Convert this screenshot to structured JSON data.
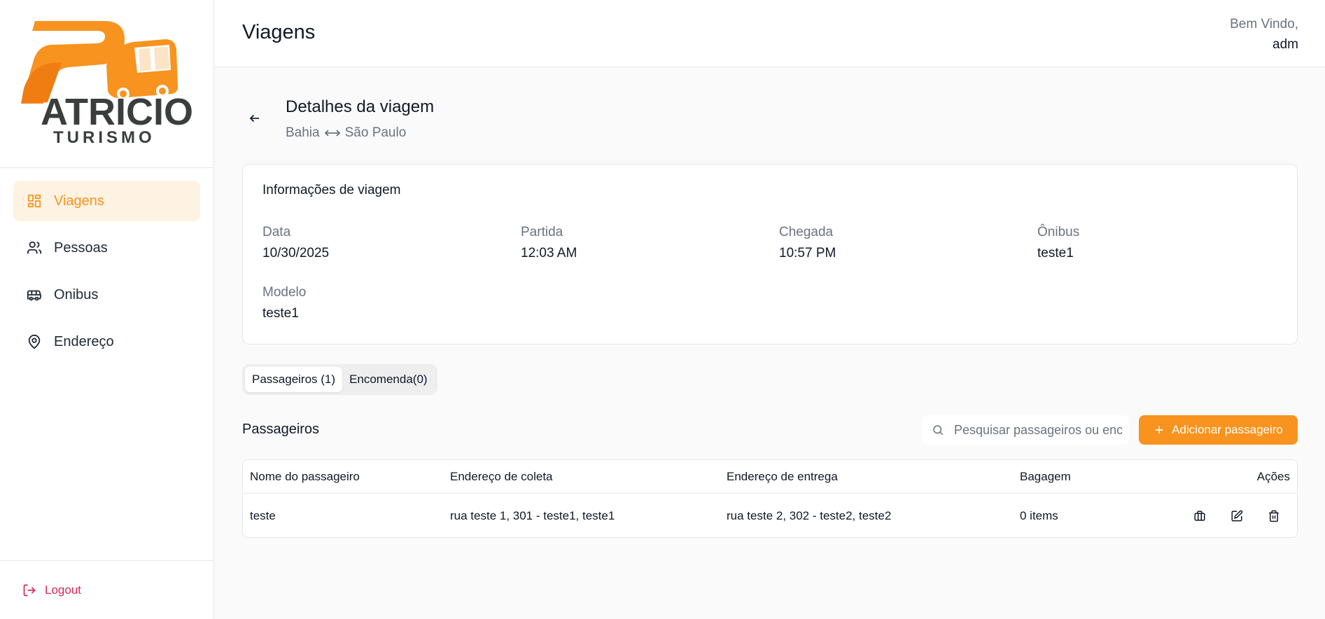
{
  "brand": {
    "logo_text_top": "ATRICIO",
    "logo_text_bottom": "TURISMO",
    "accent": "#f7931e"
  },
  "sidebar": {
    "items": [
      {
        "label": "Viagens",
        "icon": "dashboard-icon",
        "active": true
      },
      {
        "label": "Pessoas",
        "icon": "users-icon",
        "active": false
      },
      {
        "label": "Onibus",
        "icon": "bus-icon",
        "active": false
      },
      {
        "label": "Endereço",
        "icon": "map-pin-icon",
        "active": false
      }
    ],
    "logout_label": "Logout"
  },
  "header": {
    "title": "Viagens",
    "welcome_line1": "Bem Vindo,",
    "welcome_user": "adm"
  },
  "detail": {
    "title": "Detalhes da viagem",
    "origin": "Bahia",
    "destination": "São Paulo"
  },
  "info_card": {
    "title": "Informações de viagem",
    "data_label": "Data",
    "data_value": "10/30/2025",
    "partida_label": "Partida",
    "partida_value": "12:03 AM",
    "chegada_label": "Chegada",
    "chegada_value": "10:57 PM",
    "onibus_label": "Ônibus",
    "onibus_value": "teste1",
    "modelo_label": "Modelo",
    "modelo_value": "teste1"
  },
  "tabs": [
    {
      "label": "Passageiros (1)",
      "active": true
    },
    {
      "label": "Encomenda(0)",
      "active": false
    }
  ],
  "passengers": {
    "section_title": "Passageiros",
    "search_placeholder": "Pesquisar passageiros ou encomendas",
    "add_label": "Adicionar passageiro",
    "columns": [
      "Nome do passageiro",
      "Endereço de coleta",
      "Endereço de entrega",
      "Bagagem",
      "Ações"
    ],
    "rows": [
      {
        "name": "teste",
        "pickup": "rua teste 1, 301 - teste1, teste1",
        "delivery": "rua teste 2, 302 - teste2, teste2",
        "baggage": "0 items"
      }
    ]
  }
}
